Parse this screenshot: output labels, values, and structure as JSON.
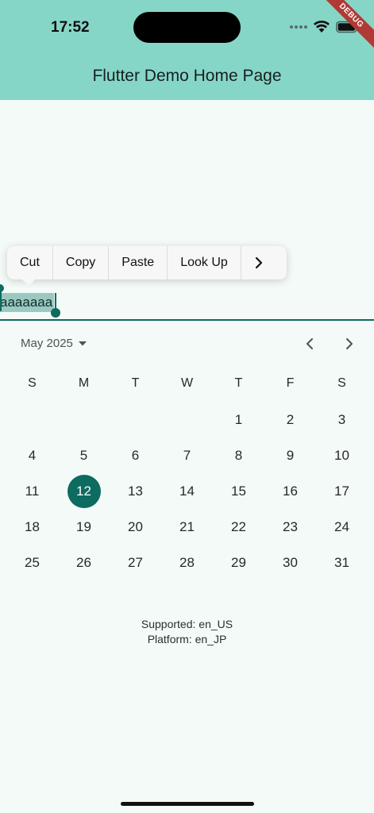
{
  "status_bar": {
    "time": "17:52"
  },
  "debug_banner": "DEBUG",
  "app_bar": {
    "title": "Flutter Demo Home Page"
  },
  "text_toolbar": {
    "items": [
      "Cut",
      "Copy",
      "Paste",
      "Look Up"
    ],
    "more_icon": "chevron-right-icon"
  },
  "text_field": {
    "selected_text": "aaaaaaa"
  },
  "calendar": {
    "month_label": "May 2025",
    "weekdays": [
      "S",
      "M",
      "T",
      "W",
      "T",
      "F",
      "S"
    ],
    "leading_blanks": 4,
    "days_in_month": 31,
    "selected_day": 12,
    "accent_color": "#0d6b60"
  },
  "locale_info": {
    "supported": "Supported: en_US",
    "platform": "Platform: en_JP"
  },
  "colors": {
    "app_bar": "#86d6c8",
    "background": "#f4faf8",
    "accent": "#0d6b60"
  }
}
